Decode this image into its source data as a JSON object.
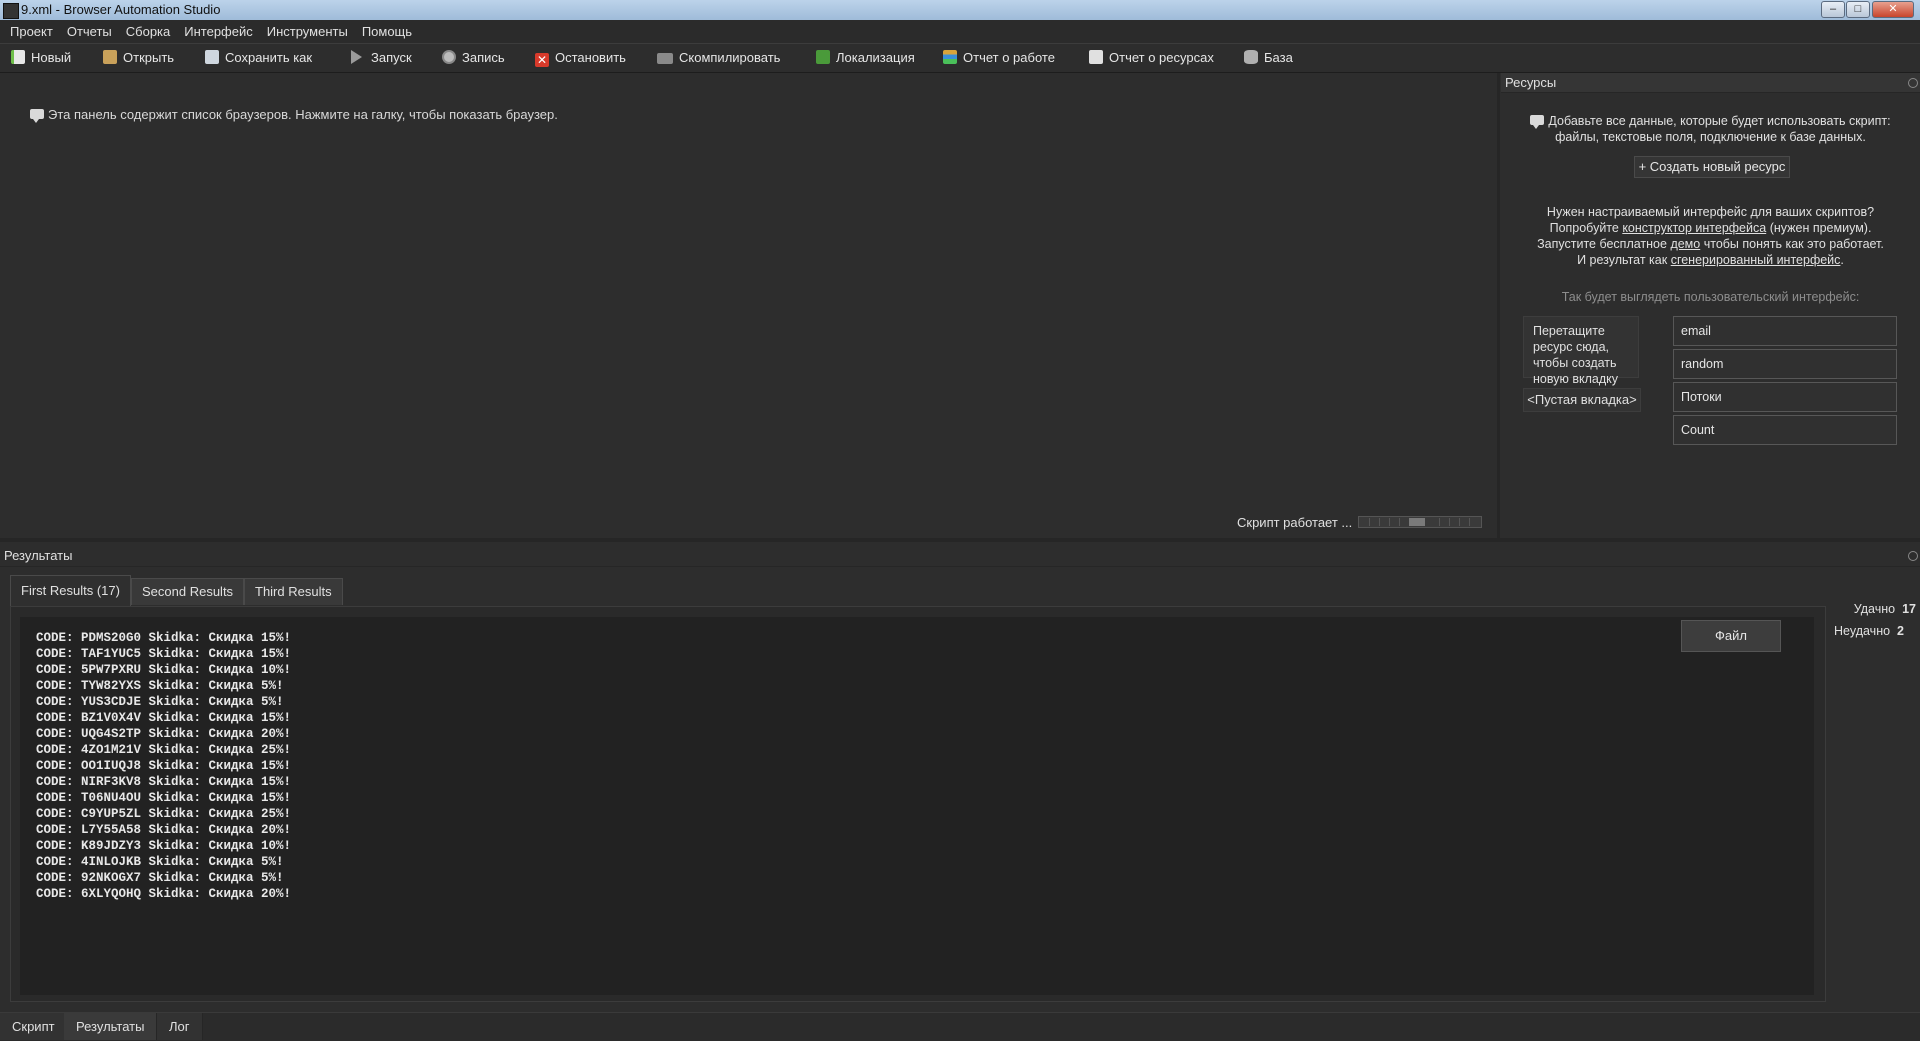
{
  "window": {
    "title": "9.xml - Browser Automation Studio",
    "min": "–",
    "max": "□",
    "close": "✕"
  },
  "menu": [
    "Проект",
    "Отчеты",
    "Сборка",
    "Интерфейс",
    "Инструменты",
    "Помощь"
  ],
  "toolbar": {
    "new": "Новый",
    "open": "Открыть",
    "save_as": "Сохранить как",
    "run": "Запуск",
    "record": "Запись",
    "stop": "Остановить",
    "compile": "Скомпилировать",
    "localization": "Локализация",
    "work_report": "Отчет о работе",
    "resource_report": "Отчет о ресурсах",
    "database": "База"
  },
  "browser_panel": {
    "hint": "Эта панель содержит список браузеров. Нажмите на галку, чтобы показать браузер.",
    "status": "Скрипт работает ..."
  },
  "resources": {
    "title": "Ресурсы",
    "desc_line1": "Добавьте все данные, которые будет использовать скрипт:",
    "desc_line2": "файлы, текстовые поля, подключение к базе данных.",
    "create_button": "+ Создать новый ресурс",
    "promo_line1": "Нужен настраиваемый интерфейс для ваших скриптов?",
    "promo_try": "Попробуйте",
    "promo_link1": "конструктор интерфейса",
    "promo_premium": "(нужен премиум).",
    "promo_run": "Запустите бесплатное",
    "promo_link2": "демо",
    "promo_run_tail": "чтобы понять как это работает.",
    "promo_result": "И результат как",
    "promo_link3": "сгенерированный интерфейс",
    "promo_dot": ".",
    "preview_title": "Так будет выглядеть пользовательский интерфейс:",
    "drop_hint": "Перетащите ресурс сюда, чтобы создать новую вкладку",
    "empty_tab": "<Пустая вкладка>",
    "fields": [
      "email",
      "random",
      "Потоки",
      "Count"
    ]
  },
  "results": {
    "title": "Результаты",
    "tabs": [
      "First Results (17)",
      "Second Results",
      "Third Results"
    ],
    "lines": [
      "CODE: PDMS20G0 Skidka: Скидка 15%!",
      "CODE: TAF1YUC5 Skidka: Скидка 15%!",
      "CODE: 5PW7PXRU Skidka: Скидка 10%!",
      "CODE: TYW82YXS Skidka: Скидка 5%!",
      "CODE: YUS3CDJE Skidka: Скидка 5%!",
      "CODE: BZ1V0X4V Skidka: Скидка 15%!",
      "CODE: UQG4S2TP Skidka: Скидка 20%!",
      "CODE: 4ZO1M21V Skidka: Скидка 25%!",
      "CODE: OO1IUQJ8 Skidka: Скидка 15%!",
      "CODE: NIRF3KV8 Skidka: Скидка 15%!",
      "CODE: T06NU4OU Skidka: Скидка 15%!",
      "CODE: C9YUP5ZL Skidka: Скидка 25%!",
      "CODE: L7Y55A58 Skidka: Скидка 20%!",
      "CODE: K89JDZY3 Skidka: Скидка 10%!",
      "CODE: 4INLOJKB Skidka: Скидка 5%!",
      "CODE: 92NKOGX7 Skidka: Скидка 5%!",
      "CODE: 6XLYQOHQ Skidka: Скидка 20%!"
    ],
    "file_button": "Файл",
    "success_label": "Удачно",
    "success_count": "17",
    "fail_label": "Неудачно",
    "fail_count": "2"
  },
  "bottom_tabs": [
    "Скрипт",
    "Результаты",
    "Лог"
  ],
  "progress_fraction": 0.5,
  "colors": {
    "bg": "#2d2d2d",
    "stop_red": "#d83a2b",
    "new_green": "#6fbf4a"
  }
}
